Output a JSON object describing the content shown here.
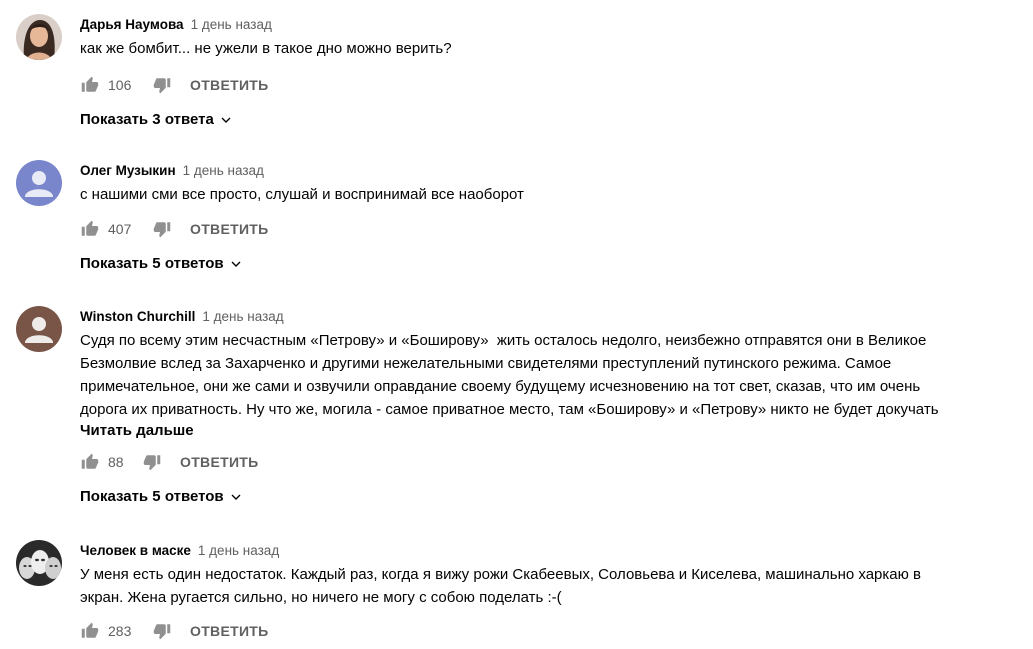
{
  "comments": [
    {
      "author": "Дарья Наумова",
      "time": "1 день назад",
      "text": "как же бомбит... не ужели в такое дно можно верить?",
      "likes": "106",
      "reply_label": "ОТВЕТИТЬ",
      "replies_label": "Показать 3 ответа",
      "avatar": "photo-woman"
    },
    {
      "author": "Олег Музыкин",
      "time": "1 день назад",
      "text": "с нашими сми все просто, слушай и воспринимай все наоборот",
      "likes": "407",
      "reply_label": "ОТВЕТИТЬ",
      "replies_label": "Показать 5 ответов",
      "avatar": "default-blue",
      "avatar_color": "#7986cb"
    },
    {
      "author": "Winston Churchill",
      "time": "1 день назад",
      "text": "Судя по всему этим несчастным «Петрову» и «Боширову»  жить осталось недолго, неизбежно отправятся они в Великое\nБезмолвие вслед за Захарченко и другими нежелательными свидетелями преступлений путинского режима. Самое\nпримечательное, они же сами и озвучили оправдание своему будущему исчезновению на тот свет, сказав, что им очень\nдорога их приватность. Ну что же, могила - самое приватное место, там «Боширову» и «Петрову» никто не будет докучать",
      "read_more": "Читать дальше",
      "likes": "88",
      "reply_label": "ОТВЕТИТЬ",
      "replies_label": "Показать 5 ответов",
      "avatar": "default-brown",
      "avatar_color": "#795548"
    },
    {
      "author": "Человек в маске",
      "time": "1 день назад",
      "text": "У меня есть один недостаток. Каждый раз, когда я вижу рожи Скабеевых, Соловьева и Киселева, машинально харкаю в\nэкран. Жена ругается сильно, но ничего не могу с собою поделать :-(",
      "likes": "283",
      "reply_label": "ОТВЕТИТЬ",
      "avatar": "photo-masks"
    }
  ],
  "icons": {
    "like": "thumb-up-icon",
    "dislike": "thumb-down-icon",
    "expand": "chevron-down-icon"
  }
}
